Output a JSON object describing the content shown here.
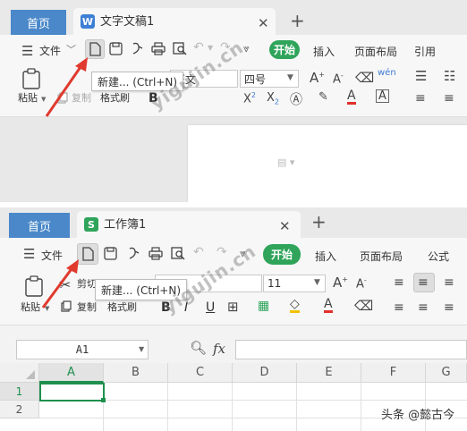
{
  "writer": {
    "home_tab": "首页",
    "doc_tab": "文字文稿1",
    "menu": {
      "file": "文件",
      "start": "开始",
      "insert": "插入",
      "layout": "页面布局",
      "reference": "引用"
    },
    "ribbon": {
      "paste": "粘贴",
      "copy": "复制",
      "format_painter": "格式刷",
      "font": "正文",
      "font_size": "四号"
    },
    "tooltip": "新建... (Ctrl+N)"
  },
  "spreadsheet": {
    "home_tab": "首页",
    "sheet_tab": "工作簿1",
    "menu": {
      "file": "文件",
      "start": "开始",
      "insert": "插入",
      "layout": "页面布局",
      "formula": "公式"
    },
    "ribbon": {
      "paste": "粘贴",
      "cut": "剪切",
      "copy": "复制",
      "format_painter": "格式刷",
      "font_size": "11"
    },
    "tooltip": "新建... (Ctrl+N)",
    "name_box": "A1",
    "fx": "fx",
    "columns": [
      "A",
      "B",
      "C",
      "D",
      "E",
      "F",
      "G"
    ],
    "rows": [
      "1",
      "2"
    ]
  },
  "watermark": "yigujin.cn",
  "footer_credit": "头条 @懿古今",
  "colors": {
    "home_tab_blue": "#4a88c9",
    "start_green": "#2fa45a",
    "arrow_red": "#e03a2e",
    "cell_selection": "#1e8f4e"
  }
}
